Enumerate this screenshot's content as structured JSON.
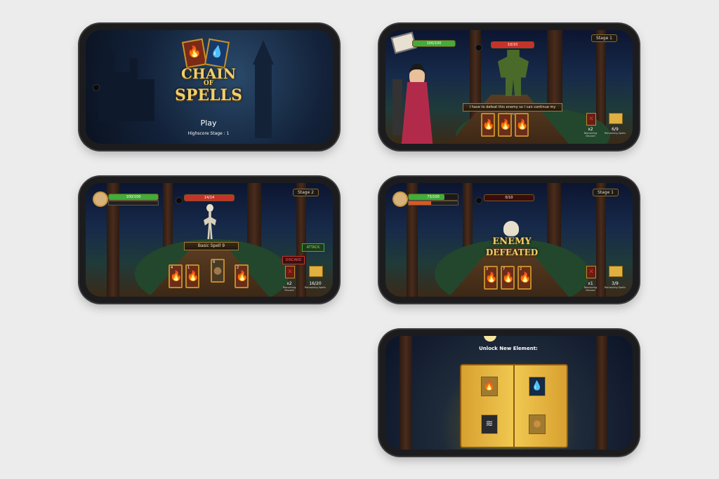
{
  "screen_title": {
    "logo_line1": "CHAIN",
    "logo_line2": "OF",
    "logo_line3": "SPELLS",
    "play_label": "Play",
    "highscore": "Highscore Stage : 1"
  },
  "screen_dialog": {
    "player_hp": "100/100",
    "enemy_hp": "10/10",
    "stage": "Stage 1",
    "dialog_text": "I have to defeat this enemy so I can continue my journey",
    "cards": [
      "",
      "",
      ""
    ],
    "discard_count": "x2",
    "discard_label": "Remaining Discard",
    "spells_count": "6/9",
    "spells_label": "Remaining Spells"
  },
  "screen_battle": {
    "player_hp": "100/100",
    "enemy_hp": "14/14",
    "stage": "Stage 2",
    "spell_name": "Basic Spell 9",
    "attack_label": "ATTACK",
    "discard_label": "DISCARD",
    "cards": [
      "4",
      "1",
      "9",
      "2"
    ],
    "discard_count": "x2",
    "discard_caption": "Remaining Discard",
    "spells_count": "16/20",
    "spells_caption": "Remaining Spells"
  },
  "screen_defeated": {
    "player_hp": "73/100",
    "enemy_hp": "0/10",
    "stage": "Stage 1",
    "defeated_line1": "ENEMY",
    "defeated_line2": "DEFEATED",
    "cards": [
      "3",
      "7",
      "2"
    ],
    "discard_count": "x1",
    "discard_caption": "Remaining Discard",
    "spells_count": "3/9",
    "spells_caption": "Remaining Spells"
  },
  "screen_unlock": {
    "title": "Unlock New Element:"
  },
  "colors": {
    "hp_green": "#3fae3a",
    "enemy_red": "#c8322a",
    "gold": "#c08a2a"
  }
}
